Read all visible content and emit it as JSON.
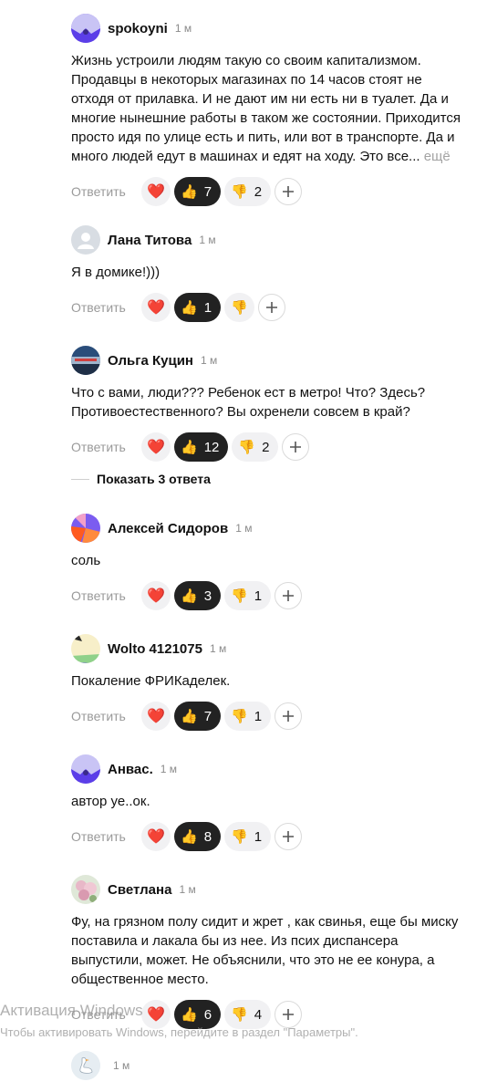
{
  "ui": {
    "reply_label": "Ответить",
    "more_label": "ещё"
  },
  "comments": [
    {
      "author": "spokoyni",
      "time": "1 м",
      "avatar": "purple-face",
      "text": "Жизнь устроили людям такую со своим капитализмом.\nПродавцы в некоторых магазинах по 14 часов стоят не\nотходя от прилавка. И не дают им ни есть ни в туалет. Да и\nмногие нынешние работы в таком же состоянии. Приходится\nпросто идя по улице есть и пить, или вот в транспорте. Да и\nмного людей едут в машинах и едят на ходу. Это все...",
      "likes": "7",
      "dislikes": "2",
      "truncated": true
    },
    {
      "author": "Лана Титова",
      "time": "1 м",
      "avatar": "default-user",
      "text": "Я в домике!)))",
      "likes": "1",
      "dislikes": ""
    },
    {
      "author": "Ольга Куцин",
      "time": "1 м",
      "avatar": "photo-blue",
      "text": "Что с вами, люди??? Ребенок ест в метро! Что? Здесь?\nПротивоестественного? Вы охренели совсем в край?",
      "likes": "12",
      "dislikes": "2"
    },
    {
      "author": "Алексей Сидоров",
      "time": "1 м",
      "avatar": "geo-orange-purple",
      "text": "соль",
      "likes": "3",
      "dislikes": "1"
    },
    {
      "author": "Wolto 4121075",
      "time": "1 м",
      "avatar": "geo-cream-green",
      "text": "Покаление ФРИКаделек.",
      "likes": "7",
      "dislikes": "1"
    },
    {
      "author": "Анвас.",
      "time": "1 м",
      "avatar": "purple-face",
      "text": "автор уе..ок.",
      "likes": "8",
      "dislikes": "1"
    },
    {
      "author": "Светлана",
      "time": "1 м",
      "avatar": "photo-flowers",
      "text": "Фу, на грязном полу сидит и жрет , как свинья, еще бы миску\nпоставила и лакала бы из нее. Из псих диспансера\nвыпустили, может. Не объяснили, что это не ее конура, а\nобщественное место.",
      "likes": "6",
      "dislikes": "4"
    }
  ],
  "show_replies": {
    "label": "Показать 3 ответа"
  },
  "last_comment": {
    "time": "1 м",
    "avatar": "goose"
  },
  "watermark": {
    "title": "Активация Windows",
    "subtitle": "Чтобы активировать Windows, перейдите в раздел \"Параметры\"."
  }
}
